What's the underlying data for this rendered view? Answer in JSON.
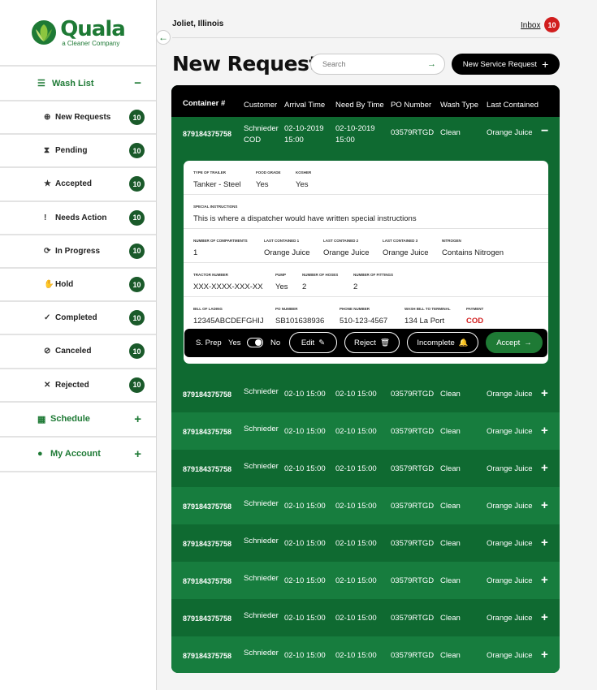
{
  "sidebar": {
    "logo_name": "Quala",
    "logo_tag": "a Cleaner Company",
    "collapse_icon": "←",
    "wash_list": {
      "label": "Wash List",
      "icon": "☰",
      "toggle": "−"
    },
    "items": [
      {
        "label": "New Requests",
        "icon": "⊕",
        "count": "10"
      },
      {
        "label": "Pending",
        "icon": "⧗",
        "count": "10"
      },
      {
        "label": "Accepted",
        "icon": "★",
        "count": "10"
      },
      {
        "label": "Needs Action",
        "icon": "!",
        "count": "10"
      },
      {
        "label": "In Progress",
        "icon": "⟳",
        "count": "10"
      },
      {
        "label": "Hold",
        "icon": "✋",
        "count": "10"
      },
      {
        "label": "Completed",
        "icon": "✓",
        "count": "10"
      },
      {
        "label": "Canceled",
        "icon": "⊘",
        "count": "10"
      },
      {
        "label": "Rejected",
        "icon": "✕",
        "count": "10"
      }
    ],
    "schedule": {
      "label": "Schedule",
      "icon": "▦",
      "toggle": "+"
    },
    "account": {
      "label": "My Account",
      "icon": "●",
      "toggle": "+"
    }
  },
  "header": {
    "location": "Joliet, Illinois",
    "inbox_label": "Inbox",
    "inbox_count": "10",
    "title": "New Requests",
    "search_placeholder": "Search",
    "search_icon": "→",
    "new_button": "New Service Request",
    "new_button_icon": "+"
  },
  "table": {
    "columns": {
      "container": "Container #",
      "customer": "Customer",
      "arrival": "Arrival Time",
      "need": "Need By Time",
      "po": "PO Number",
      "wash": "Wash Type",
      "last": "Last Contained"
    },
    "expanded": {
      "container": "879184375758",
      "customer_1": "Schnieder",
      "customer_2": "COD",
      "arrival_date": "02-10-2019",
      "arrival_time": "15:00",
      "need_date": "02-10-2019",
      "need_time": "15:00",
      "po": "03579RTGD",
      "wash": "Clean",
      "last": "Orange Juice",
      "toggle": "−"
    },
    "detail": {
      "type_label": "Type of Trailer",
      "type": "Tanker - Steel",
      "food_label": "Food Grade",
      "food": "Yes",
      "kosher_label": "Kosher",
      "kosher": "Yes",
      "instr_label": "Special Instructions",
      "instr": "This is where a dispatcher would have written special instructions",
      "comp_label": "Number of Compartments",
      "comp": "1",
      "lc1_label": "Last Contained 1",
      "lc1": "Orange Juice",
      "lc2_label": "Last Contained 2",
      "lc2": "Orange Juice",
      "lc3_label": "Last Contained 3",
      "lc3": "Orange Juice",
      "nitro_label": "Nitrogen",
      "nitro": "Contains Nitrogen",
      "tractor_label": "Tractor Number",
      "tractor": "XXX-XXXX-XXX-XX",
      "pump_label": "Pump",
      "pump": "Yes",
      "hoses_label": "Number of Hoses",
      "hoses": "2",
      "fittings_label": "Number of Fittings",
      "fittings": "2",
      "bol_label": "Bill of Lading",
      "bol": "12345ABCDEFGHIJ",
      "po_label": "PO Number",
      "po": "SB101638936",
      "phone_label": "Phone Number",
      "phone": "510-123-4567",
      "terminal_label": "Wash Bill to Terminal",
      "terminal": "134 La Port",
      "payment_label": "Payment",
      "payment": "COD"
    },
    "actions": {
      "sprep": "S. Prep",
      "yes": "Yes",
      "no": "No",
      "edit": "Edit",
      "edit_icon": "✎",
      "reject": "Reject",
      "reject_icon": "🗑",
      "incomplete": "Incomplete",
      "incomplete_icon": "🔔",
      "accept": "Accept",
      "accept_icon": "→"
    },
    "rows": [
      {
        "container": "879184375758",
        "customer": "Schnieder",
        "arrival": "02-10 15:00",
        "need": "02-10 15:00",
        "po": "03579RTGD",
        "wash": "Clean",
        "last": "Orange Juice",
        "toggle": "+"
      },
      {
        "container": "879184375758",
        "customer": "Schnieder",
        "arrival": "02-10 15:00",
        "need": "02-10 15:00",
        "po": "03579RTGD",
        "wash": "Clean",
        "last": "Orange Juice",
        "toggle": "+"
      },
      {
        "container": "879184375758",
        "customer": "Schnieder",
        "arrival": "02-10 15:00",
        "need": "02-10 15:00",
        "po": "03579RTGD",
        "wash": "Clean",
        "last": "Orange Juice",
        "toggle": "+"
      },
      {
        "container": "879184375758",
        "customer": "Schnieder",
        "arrival": "02-10 15:00",
        "need": "02-10 15:00",
        "po": "03579RTGD",
        "wash": "Clean",
        "last": "Orange Juice",
        "toggle": "+"
      },
      {
        "container": "879184375758",
        "customer": "Schnieder",
        "arrival": "02-10 15:00",
        "need": "02-10 15:00",
        "po": "03579RTGD",
        "wash": "Clean",
        "last": "Orange Juice",
        "toggle": "+"
      },
      {
        "container": "879184375758",
        "customer": "Schnieder",
        "arrival": "02-10 15:00",
        "need": "02-10 15:00",
        "po": "03579RTGD",
        "wash": "Clean",
        "last": "Orange Juice",
        "toggle": "+"
      },
      {
        "container": "879184375758",
        "customer": "Schnieder",
        "arrival": "02-10 15:00",
        "need": "02-10 15:00",
        "po": "03579RTGD",
        "wash": "Clean",
        "last": "Orange Juice",
        "toggle": "+"
      },
      {
        "container": "879184375758",
        "customer": "Schnieder",
        "arrival": "02-10 15:00",
        "need": "02-10 15:00",
        "po": "03579RTGD",
        "wash": "Clean",
        "last": "Orange Juice",
        "toggle": "+"
      }
    ]
  }
}
